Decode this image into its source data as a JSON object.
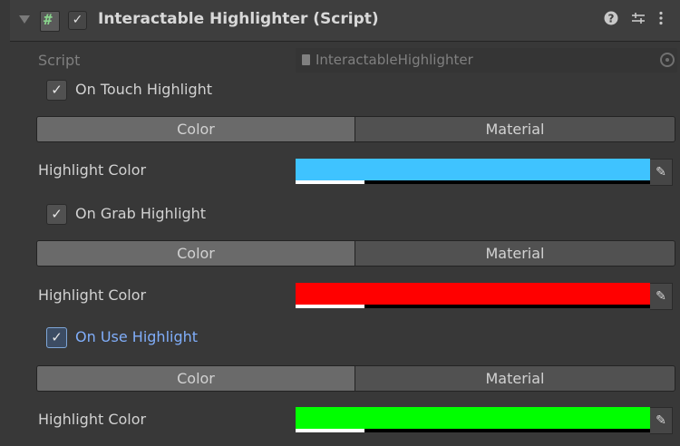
{
  "component": {
    "title": "Interactable Highlighter (Script)",
    "enabled_checkmark": "✓",
    "script_icon_glyph": "#",
    "header_icons": {
      "help": "❓",
      "presets": "⚙",
      "menu": "⋮"
    }
  },
  "script_row": {
    "label": "Script",
    "value": "InteractableHighlighter"
  },
  "sections": [
    {
      "toggle_label": "On Touch Highlight",
      "checked": "✓",
      "tabs": {
        "color": "Color",
        "material": "Material",
        "active": "Color"
      },
      "color_label": "Highlight Color",
      "color": "#3fc3ff"
    },
    {
      "toggle_label": "On Grab Highlight",
      "checked": "✓",
      "tabs": {
        "color": "Color",
        "material": "Material",
        "active": "Color"
      },
      "color_label": "Highlight Color",
      "color": "#ff0000"
    },
    {
      "toggle_label": "On Use Highlight",
      "checked": "✓",
      "tabs": {
        "color": "Color",
        "material": "Material",
        "active": "Color"
      },
      "color_label": "Highlight Color",
      "color": "#00ff00"
    }
  ],
  "picker_glyph": "✎",
  "icons": [
    "foldout-arrow-icon",
    "script-icon",
    "help-icon",
    "presets-icon",
    "menu-icon",
    "object-picker-icon",
    "eyedropper-icon"
  ]
}
